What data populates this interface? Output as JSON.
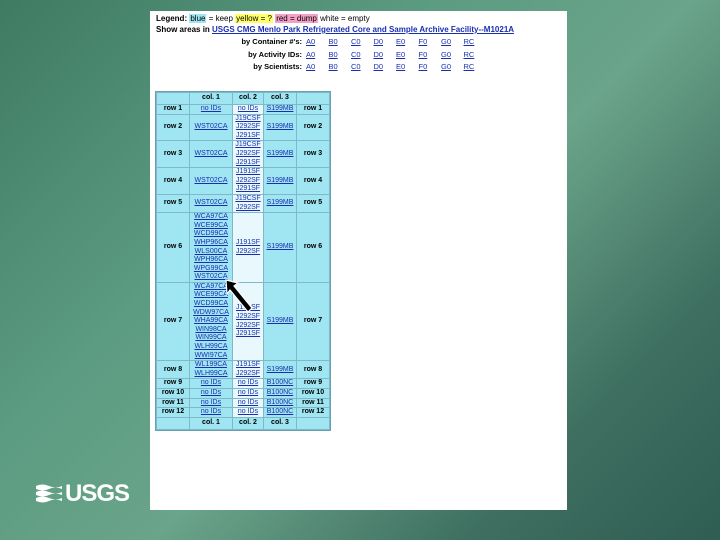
{
  "legend": {
    "label": "Legend:",
    "blue": "blue",
    "blue_eq": " = keep ",
    "yellow": "yellow = ?",
    "red": "red = dump",
    "white": " white = empty"
  },
  "title": {
    "prefix": "Show areas in ",
    "link": "USGS CMG Menlo Park Refrigerated Core and Sample Archive Facility--M1021A"
  },
  "filters": [
    {
      "label": "by Container #'s:",
      "links": [
        "A0",
        "B0",
        "C0",
        "D0",
        "E0",
        "F0",
        "G0",
        "RC"
      ]
    },
    {
      "label": "by Activity IDs:",
      "links": [
        "A0",
        "B0",
        "C0",
        "D0",
        "E0",
        "F0",
        "G0",
        "RC"
      ]
    },
    {
      "label": "by Scientists:",
      "links": [
        "A0",
        "B0",
        "C0",
        "D0",
        "E0",
        "F0",
        "G0",
        "RC"
      ]
    }
  ],
  "grid": {
    "col_headers": [
      "col. 1",
      "col. 2",
      "col. 3"
    ],
    "rows": [
      {
        "label": "row 1",
        "c1": [
          "no IDs"
        ],
        "c2": [
          "no IDs"
        ],
        "c3": [
          "S199MB"
        ]
      },
      {
        "label": "row 2",
        "c1": [
          "WST02CA"
        ],
        "c2": [
          "J19CSF",
          "J292SF",
          "J291SF"
        ],
        "c3": [
          "S199MB"
        ]
      },
      {
        "label": "row 3",
        "c1": [
          "WST02CA"
        ],
        "c2": [
          "J19CSF",
          "J292SF",
          "J291SF"
        ],
        "c3": [
          "S199MB"
        ]
      },
      {
        "label": "row 4",
        "c1": [
          "WST02CA"
        ],
        "c2": [
          "J191SF",
          "J292SF",
          "J291SF"
        ],
        "c3": [
          "S199MB"
        ]
      },
      {
        "label": "row 5",
        "c1": [
          "WST02CA"
        ],
        "c2": [
          "J19CSF",
          "J292SF"
        ],
        "c3": [
          "S199MB"
        ]
      },
      {
        "label": "row 6",
        "c1": [
          "WCA97CA",
          "WCE99CA",
          "WCD99CA",
          "WHP96CA",
          "WLS00CA",
          "WPH96CA",
          "WPG99CA",
          "WST02CA"
        ],
        "c2": [
          "J191SF",
          "J292SF"
        ],
        "c3": [
          "S199MB"
        ]
      },
      {
        "label": "row 7",
        "c1": [
          "WCA97CA",
          "WCE99CA",
          "WCD99CA",
          "WDW97CA",
          "WHA99CA",
          "WIN98CA",
          "WIN99CA",
          "WLH99CA",
          "WWI97CA"
        ],
        "c2": [
          "J191SF",
          "J292SF",
          "J292SF",
          "J291SF"
        ],
        "c3": [
          "S199MB"
        ]
      },
      {
        "label": "row 8",
        "c1": [
          "WL199CA",
          "WLH99CA"
        ],
        "c2": [
          "J191SF",
          "J292SF"
        ],
        "c3": [
          "S199MB"
        ]
      },
      {
        "label": "row 9",
        "c1": [
          "no IDs"
        ],
        "c2": [
          "no IDs"
        ],
        "c3": [
          "B100NC"
        ]
      },
      {
        "label": "row 10",
        "c1": [
          "no IDs"
        ],
        "c2": [
          "no IDs"
        ],
        "c3": [
          "B100NC"
        ]
      },
      {
        "label": "row 11",
        "c1": [
          "no IDs"
        ],
        "c2": [
          "no IDs"
        ],
        "c3": [
          "B100NC"
        ]
      },
      {
        "label": "row 12",
        "c1": [
          "no IDs"
        ],
        "c2": [
          "no IDs"
        ],
        "c3": [
          "B100NC"
        ]
      }
    ]
  },
  "logo": {
    "text": "USGS"
  },
  "colors": {
    "cell_blue": "#9fe6f2",
    "link": "#1a2fb0",
    "yellow": "#ffff66",
    "red": "#f5a0c6"
  },
  "icons": {
    "pointer": "arrow-pointer-icon",
    "logo_mark": "usgs-wave-icon"
  }
}
